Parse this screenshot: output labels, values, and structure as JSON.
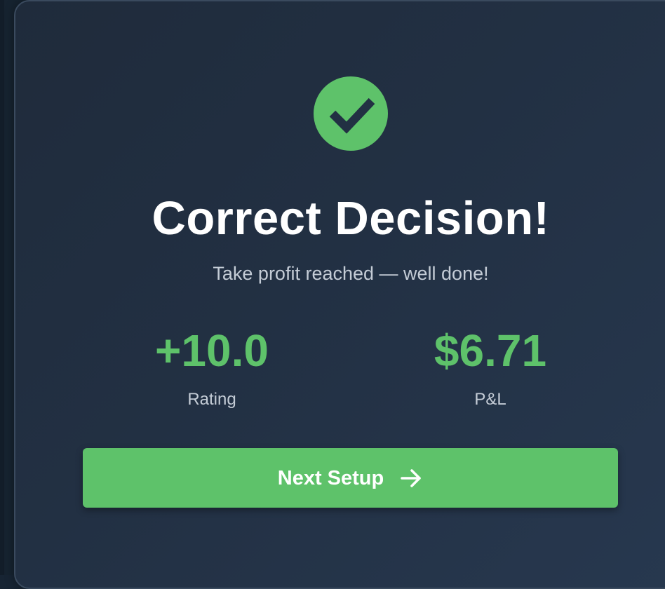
{
  "result": {
    "status_icon": "check-circle-icon",
    "title": "Correct Decision!",
    "subtitle": "Take profit reached — well done!"
  },
  "stats": [
    {
      "value": "+10.0",
      "label": "Rating"
    },
    {
      "value": "$6.71",
      "label": "P&L"
    }
  ],
  "actions": {
    "next_label": "Next Setup",
    "next_icon": "arrow-right-icon"
  },
  "colors": {
    "accent_green": "#5ec26a",
    "card_background": "#223043",
    "title_text": "#ffffff",
    "muted_text": "#c4ccd6"
  }
}
